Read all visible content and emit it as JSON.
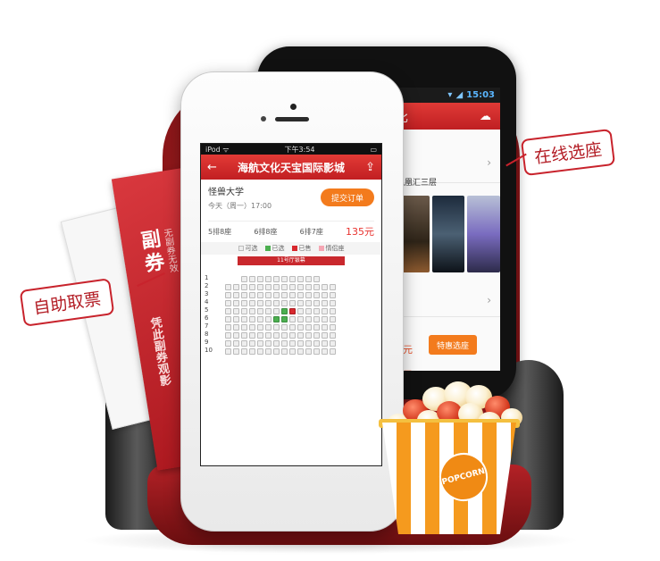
{
  "callouts": {
    "left": "自助取票",
    "right": "在线选座"
  },
  "ticket": {
    "big": "副券",
    "small": "无副券无效",
    "mid": "凭此副券观影"
  },
  "android": {
    "status_time": "15:03",
    "header_partial": "比",
    "cinema_partial": "凤凰汇三层",
    "price1_partial": "9元",
    "price2_partial": "9元",
    "button_label": "特惠选座"
  },
  "iphone": {
    "status_left": "iPod ᯤ",
    "status_time": "下午3:54",
    "title": "海航文化天宝国际影城",
    "movie_title": "怪兽大学",
    "showtime": "今天（周一）17:00",
    "submit_label": "提交订单",
    "seats": [
      "5排8座",
      "6排8座",
      "6排7座"
    ],
    "price": "135元",
    "legend": [
      "可选",
      "已选",
      "已售",
      "情侣座"
    ],
    "screen_label": "11号厅银幕",
    "row_numbers": "1\n2\n3\n4\n5\n6\n7\n8\n9\n10"
  },
  "colors": {
    "brand_red": "#c11f22",
    "accent_orange": "#f37b1d",
    "selected_green": "#4caf50"
  },
  "popcorn": {
    "badge": "POPCORN"
  }
}
